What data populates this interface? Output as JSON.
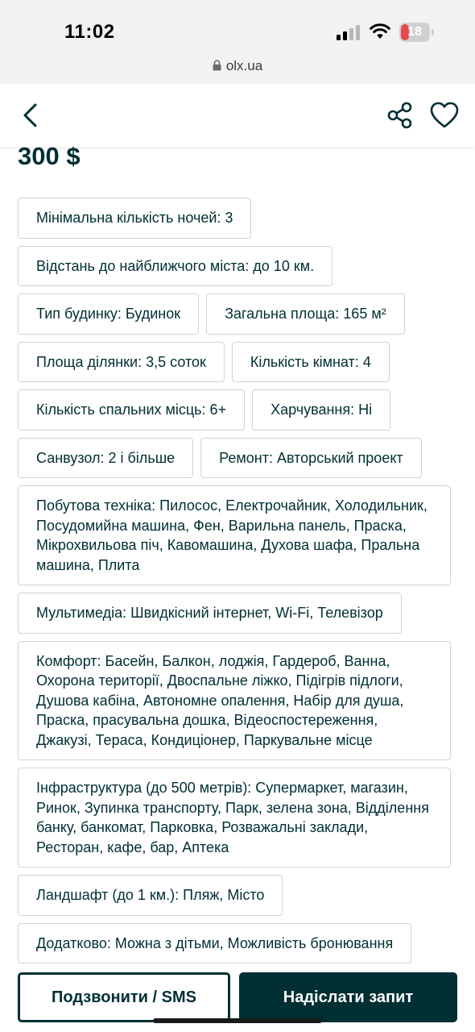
{
  "status": {
    "time": "11:02",
    "battery": "18",
    "url": "olx.ua"
  },
  "icons": {
    "back": "chevron-left",
    "share": "share-nodes",
    "favorite": "heart-outline"
  },
  "colors": {
    "brand_dark": "#002f34",
    "tag_border": "#ccd5d6",
    "battery_low": "#e5484d"
  },
  "listing": {
    "price": "300 $",
    "attributes": [
      "Мінімальна кількість ночей: 3",
      "Відстань до найближчого міста: до 10 км.",
      "Тип будинку: Будинок",
      "Загальна площа: 165 м²",
      "Площа ділянки: 3,5 соток",
      "Кількість кімнат: 4",
      "Кількість спальних місць: 6+",
      "Харчування: Ні",
      "Санвузол: 2 і більше",
      "Ремонт: Авторський проект",
      "Побутова техніка: Пилосос, Електрочайник, Холодильник, Посудомийна машина, Фен, Варильна панель, Праска, Мікрохвильова піч, Кавомашина, Духова шафа, Пральна машина, Плита",
      "Мультимедіа: Швидкісний інтернет, Wi-Fi, Телевізор",
      "Комфорт: Басейн, Балкон, лоджія, Гардероб, Ванна, Охорона території, Двоспальне ліжко, Підігрів підлоги, Душова кабіна, Автономне опалення, Набір для душа, Праска, прасувальна дошка, Відеоспостереження, Джакузі, Тераса, Кондиціонер, Паркувальне місце",
      "Інфраструктура (до 500 метрів): Супермаркет, магазин, Ринок, Зупинка транспорту, Парк, зелена зона, Відділення банку, банкомат, Парковка, Розважальні заклади, Ресторан, кафе, бар, Аптека",
      "Ландшафт (до 1 км.): Пляж, Місто",
      "Додатково: Можна з дітьми, Можливість бронювання"
    ]
  },
  "actions": {
    "call_label": "Подзвонити / SMS",
    "send_label": "Надіслати запит"
  }
}
